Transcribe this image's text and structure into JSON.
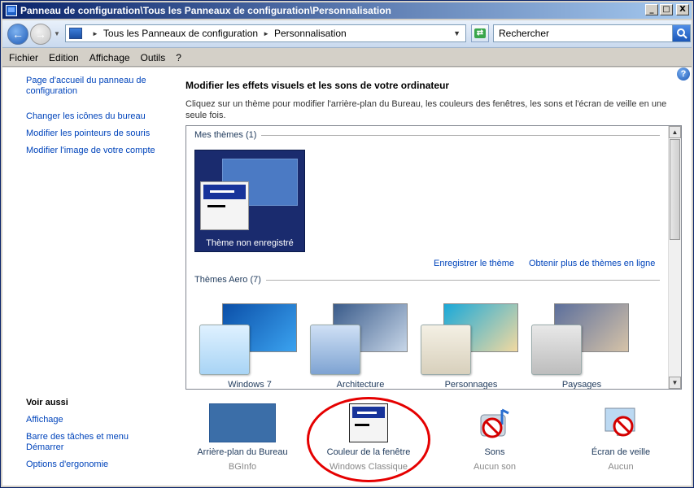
{
  "window": {
    "title": "Panneau de configuration\\Tous les Panneaux de configuration\\Personnalisation",
    "btn_min": "_",
    "btn_max": "□",
    "btn_close": "X"
  },
  "address": {
    "crumbs": [
      "Tous les Panneaux de configuration",
      "Personnalisation"
    ],
    "search_value": "Rechercher"
  },
  "menu": [
    "Fichier",
    "Edition",
    "Affichage",
    "Outils",
    "?"
  ],
  "left": {
    "links": [
      "Page d'accueil du panneau de configuration",
      "Changer les icônes du bureau",
      "Modifier les pointeurs de souris",
      "Modifier l'image de votre compte"
    ],
    "voir_aussi": "Voir aussi",
    "see_also": [
      "Affichage",
      "Barre des tâches et menu Démarrer",
      "Options d'ergonomie"
    ]
  },
  "main": {
    "heading": "Modifier les effets visuels et les sons de votre ordinateur",
    "description": "Cliquez sur un thème pour modifier l'arrière-plan du Bureau, les couleurs des fenêtres, les sons et l'écran de veille en une seule fois.",
    "my_themes_header": "Mes thèmes (1)",
    "unsaved_theme": "Thème non enregistré",
    "save_theme": "Enregistrer le thème",
    "more_themes": "Obtenir plus de thèmes en ligne",
    "aero_header": "Thèmes Aero (7)",
    "aero_themes": [
      "Windows 7",
      "Architecture",
      "Personnages",
      "Paysages"
    ]
  },
  "bottom": [
    {
      "label": "Arrière-plan du Bureau",
      "sub": "BGInfo"
    },
    {
      "label": "Couleur de la fenêtre",
      "sub": "Windows Classique"
    },
    {
      "label": "Sons",
      "sub": "Aucun son"
    },
    {
      "label": "Écran de veille",
      "sub": "Aucun"
    }
  ],
  "help_glyph": "?",
  "colors": {
    "link": "#0044bb",
    "title_start": "#0a246a",
    "title_end": "#a6caf0",
    "highlight": "#e50000"
  }
}
